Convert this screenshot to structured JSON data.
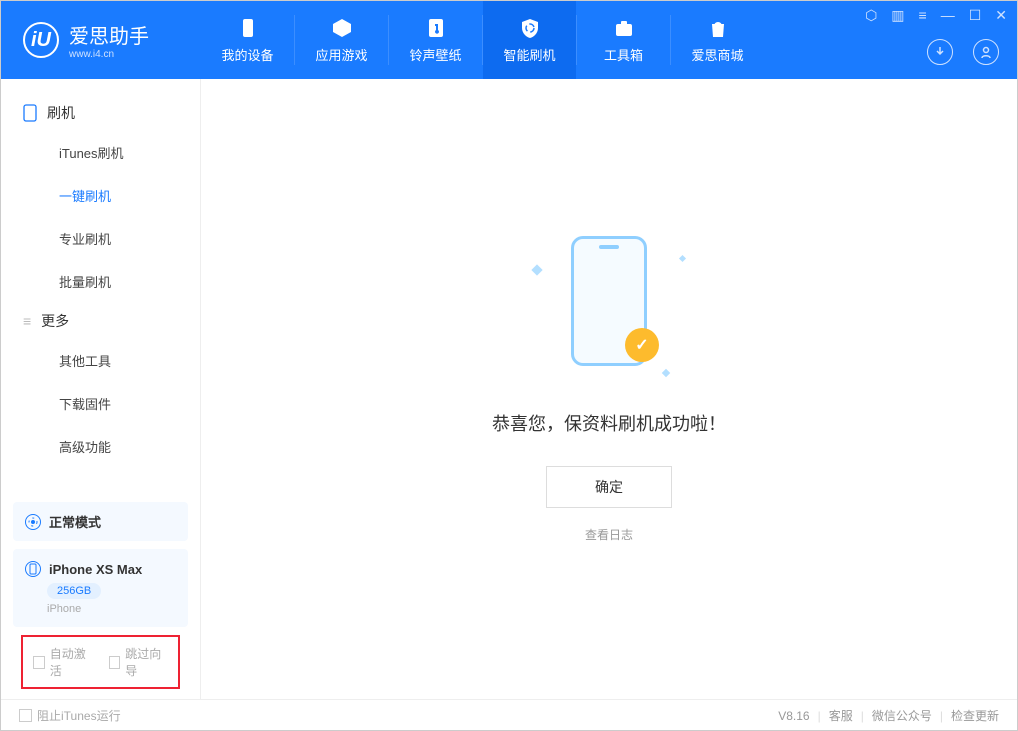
{
  "app": {
    "title": "爱思助手",
    "subtitle": "www.i4.cn"
  },
  "nav": {
    "my_device": "我的设备",
    "app_games": "应用游戏",
    "ringtone": "铃声壁纸",
    "flash": "智能刷机",
    "toolbox": "工具箱",
    "store": "爱思商城"
  },
  "sidebar": {
    "section_flash": "刷机",
    "items_flash": [
      "iTunes刷机",
      "一键刷机",
      "专业刷机",
      "批量刷机"
    ],
    "section_more": "更多",
    "items_more": [
      "其他工具",
      "下载固件",
      "高级功能"
    ]
  },
  "device": {
    "mode": "正常模式",
    "name": "iPhone XS Max",
    "storage": "256GB",
    "type": "iPhone"
  },
  "options": {
    "auto_activate": "自动激活",
    "skip_guide": "跳过向导"
  },
  "main": {
    "message": "恭喜您，保资料刷机成功啦！",
    "ok": "确定",
    "view_log": "查看日志"
  },
  "status": {
    "block_itunes": "阻止iTunes运行",
    "version": "V8.16",
    "support": "客服",
    "wechat": "微信公众号",
    "update": "检查更新"
  }
}
